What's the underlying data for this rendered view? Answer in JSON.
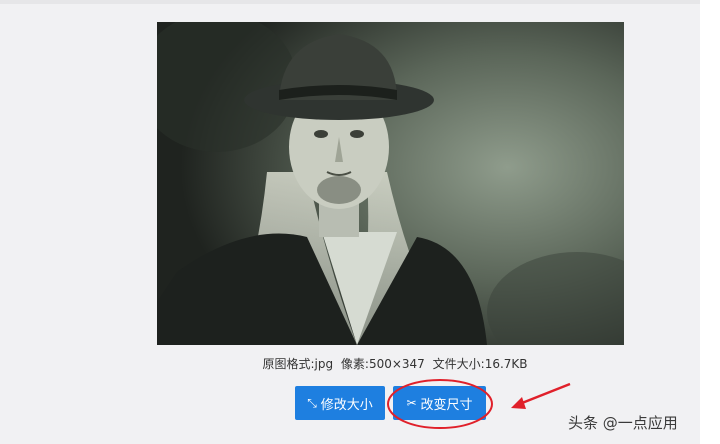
{
  "image_info": {
    "format": "原图格式:jpg",
    "pixels": "像素:500×347",
    "file_size": "文件大小:16.7KB"
  },
  "buttons": {
    "resize": {
      "label": "修改大小",
      "icon": "compress-arrows-icon"
    },
    "change_size": {
      "label": "改变尺寸",
      "icon": "scissors-icon"
    }
  },
  "watermark": {
    "text": "头条 @一点应用"
  },
  "colors": {
    "button": "#1e7fe0",
    "annotation": "#e0202a",
    "background": "#f1f1f3"
  }
}
